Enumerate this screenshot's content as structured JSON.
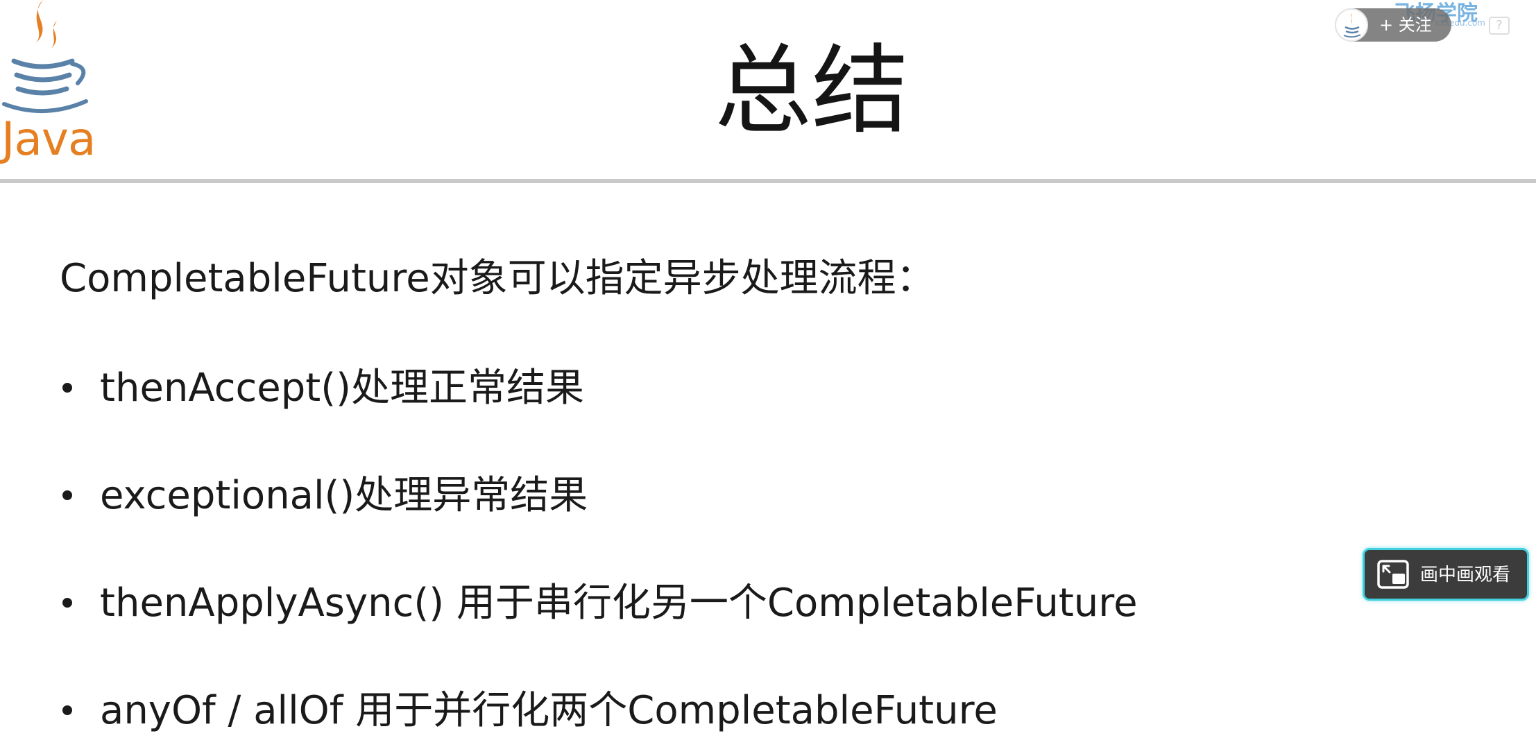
{
  "logo": {
    "icon": "java-coffee-cup-icon",
    "text": "Java",
    "colors": {
      "steam": "#e57f22",
      "cup": "#5a82a8",
      "text": "#e57f22"
    }
  },
  "slide": {
    "title": "总结",
    "intro": "CompletableFuture对象可以指定异步处理流程：",
    "bullets": [
      "thenAccept()处理正常结果",
      "exceptional()处理异常结果",
      "thenApplyAsync() 用于串行化另一个CompletableFuture",
      "anyOf / allOf 用于并行化两个CompletableFuture"
    ]
  },
  "overlay": {
    "brand": "飞扬学院",
    "brand_sub": "xxxedu.com",
    "follow_label": "+ 关注",
    "help_label": "?",
    "pip_label": "画中画观看",
    "pip_icon": "picture-in-picture-icon",
    "colors": {
      "pip_border": "#3fd1df",
      "pip_bg": "#3c3c3c"
    }
  }
}
